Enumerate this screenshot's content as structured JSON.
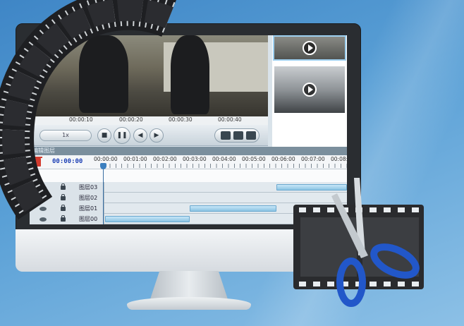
{
  "timeline": {
    "ruler_labels": [
      "00:00:10",
      "00:00:20",
      "00:00:30",
      "00:00:40"
    ],
    "speed": "1x",
    "section_title": "编辑图层",
    "current_time": "00:00:00",
    "time_labels": [
      "00:00:00",
      "00:01:00",
      "00:02:00",
      "00:03:00",
      "00:04:00",
      "00:05:00",
      "00:06:00",
      "00:07:00",
      "00:08:"
    ]
  },
  "tracks": [
    {
      "name": "图层03"
    },
    {
      "name": "图层02"
    },
    {
      "name": "图层01"
    },
    {
      "name": "图层00"
    }
  ],
  "icons": {
    "play": "play-icon",
    "stop": "stop-icon",
    "pause": "pause-icon",
    "prev": "prev-frame-icon",
    "next": "next-frame-icon",
    "save": "save-icon",
    "film": "film-icon",
    "folder": "folder-icon",
    "trash": "trash-icon",
    "eye": "eye-icon",
    "lock": "lock-icon"
  },
  "colors": {
    "accent": "#1c3fb4",
    "clip": "#8cc4e3",
    "delete": "#d23b2e"
  }
}
